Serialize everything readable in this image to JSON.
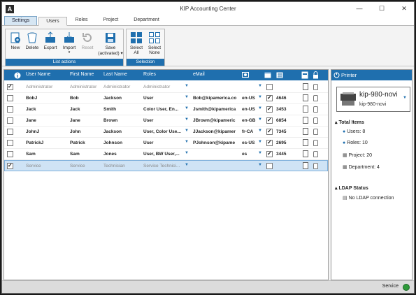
{
  "window": {
    "title": "KIP Accounting Center",
    "logo_letter": "A"
  },
  "tabs": [
    "Settings",
    "Users",
    "Roles",
    "Project",
    "Department"
  ],
  "ribbon": {
    "list_actions": {
      "label": "List actions",
      "buttons": [
        "New",
        "Delete",
        "Export",
        "Import",
        "Reset",
        "Save",
        "(activated)"
      ]
    },
    "selection": {
      "label": "Selection",
      "buttons": [
        "Select",
        "All",
        "Select",
        "None"
      ]
    }
  },
  "grid": {
    "headers": [
      "User Name",
      "First Name",
      "Last Name",
      "Roles",
      "eMail"
    ],
    "rows": [
      {
        "user": "Administrator",
        "first": "Administrator",
        "last": "Administrator",
        "roles": "Administrator",
        "email": "",
        "lang": "",
        "active": false,
        "pin": "",
        "checked": true,
        "style": "grey"
      },
      {
        "user": "BobJ",
        "first": "Bob",
        "last": "Jackson",
        "roles": "User",
        "email": "Bob@kipamerica.co",
        "lang": "en-US",
        "active": true,
        "pin": "4646",
        "checked": false,
        "style": "bold"
      },
      {
        "user": "Jack",
        "first": "Jack",
        "last": "Smith",
        "roles": "Color User, En...",
        "email": "Jsmith@kipamerica",
        "lang": "en-US",
        "active": true,
        "pin": "3453",
        "checked": false,
        "style": "bold"
      },
      {
        "user": "Jane",
        "first": "Jane",
        "last": "Brown",
        "roles": "User",
        "email": "JBrown@kipameric",
        "lang": "en-GB",
        "active": true,
        "pin": "6854",
        "checked": false,
        "style": "bold"
      },
      {
        "user": "JohnJ",
        "first": "John",
        "last": "Jackson",
        "roles": "User, Color Use...",
        "email": "JJackson@kipamer",
        "lang": "fr-CA",
        "active": true,
        "pin": "7345",
        "checked": false,
        "style": "bold"
      },
      {
        "user": "PatrickJ",
        "first": "Patrick",
        "last": "Johnson",
        "roles": "User",
        "email": "PJohnson@kipame",
        "lang": "es-US",
        "active": true,
        "pin": "2695",
        "checked": false,
        "style": "bold"
      },
      {
        "user": "Sam",
        "first": "Sam",
        "last": "Jones",
        "roles": "User, BW User,...",
        "email": "",
        "lang": "es",
        "active": true,
        "pin": "3445",
        "checked": false,
        "style": "bold"
      },
      {
        "user": "Service",
        "first": "Service",
        "last": "Technician",
        "roles": "Service Technici...",
        "email": "",
        "lang": "",
        "active": false,
        "pin": "",
        "checked": true,
        "style": "selected"
      }
    ]
  },
  "side": {
    "header": "Printer",
    "printer_name": "kip-980-novi",
    "printer_sub": "kip-980-novi",
    "total_title": "Total Items",
    "totals": [
      "Users: 8",
      "Roles: 10",
      "Project: 20",
      "Department: 4"
    ],
    "ldap_title": "LDAP Status",
    "ldap_status": "No LDAP connection"
  },
  "status": {
    "text": "Service",
    "color": "#2e9a3a"
  }
}
